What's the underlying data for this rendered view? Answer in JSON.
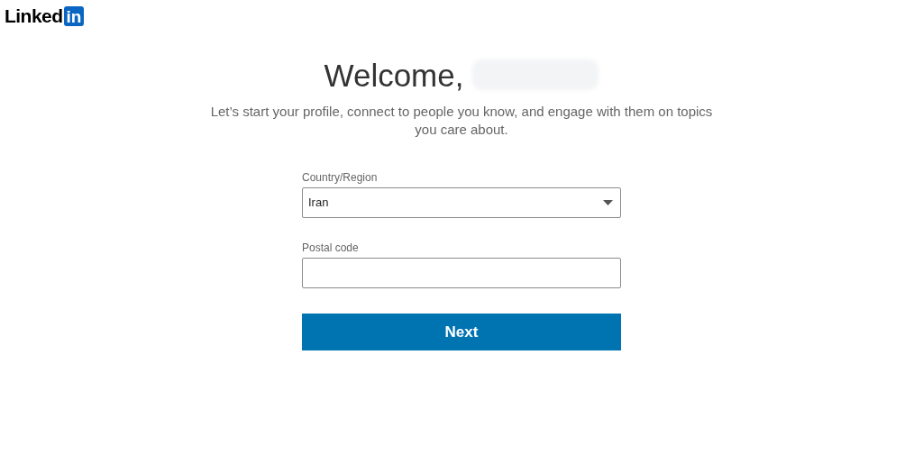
{
  "logo": {
    "word": "Linked",
    "badge": "in"
  },
  "heading": {
    "text": "Welcome,",
    "name_blurred": true
  },
  "subtitle": "Let’s start your profile, connect to people you know, and engage with them on topics you care about.",
  "fields": [
    {
      "kind": "select",
      "label": "Country/Region",
      "value": "Iran"
    },
    {
      "kind": "text",
      "label": "Postal code"
    }
  ],
  "button": "Next"
}
